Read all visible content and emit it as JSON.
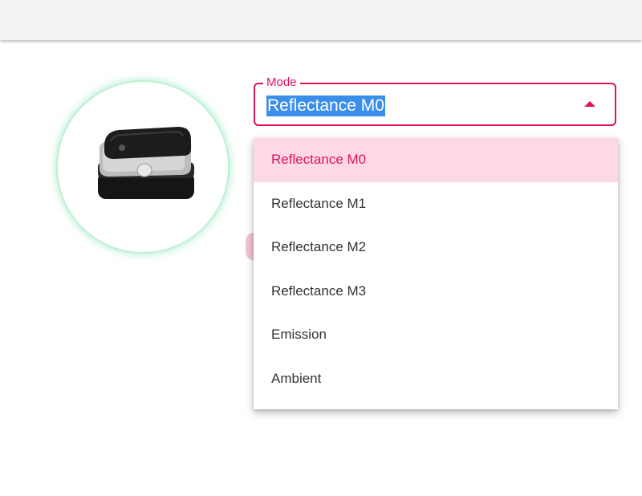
{
  "select": {
    "label": "Mode",
    "value": "Reflectance M0"
  },
  "menu": {
    "items": [
      {
        "label": "Reflectance M0",
        "selected": true
      },
      {
        "label": "Reflectance M1",
        "selected": false
      },
      {
        "label": "Reflectance M2",
        "selected": false
      },
      {
        "label": "Reflectance M3",
        "selected": false
      },
      {
        "label": "Emission",
        "selected": false
      },
      {
        "label": "Ambient",
        "selected": false
      }
    ]
  },
  "colors": {
    "accent": "#e0115f",
    "selected_bg": "#fdd9e6",
    "highlight": "#3b8eea",
    "device_ring": "#bff0d6"
  },
  "icons": {
    "dropdown_arrow": "arrow-up-icon",
    "device": "spectrophotometer-device"
  }
}
